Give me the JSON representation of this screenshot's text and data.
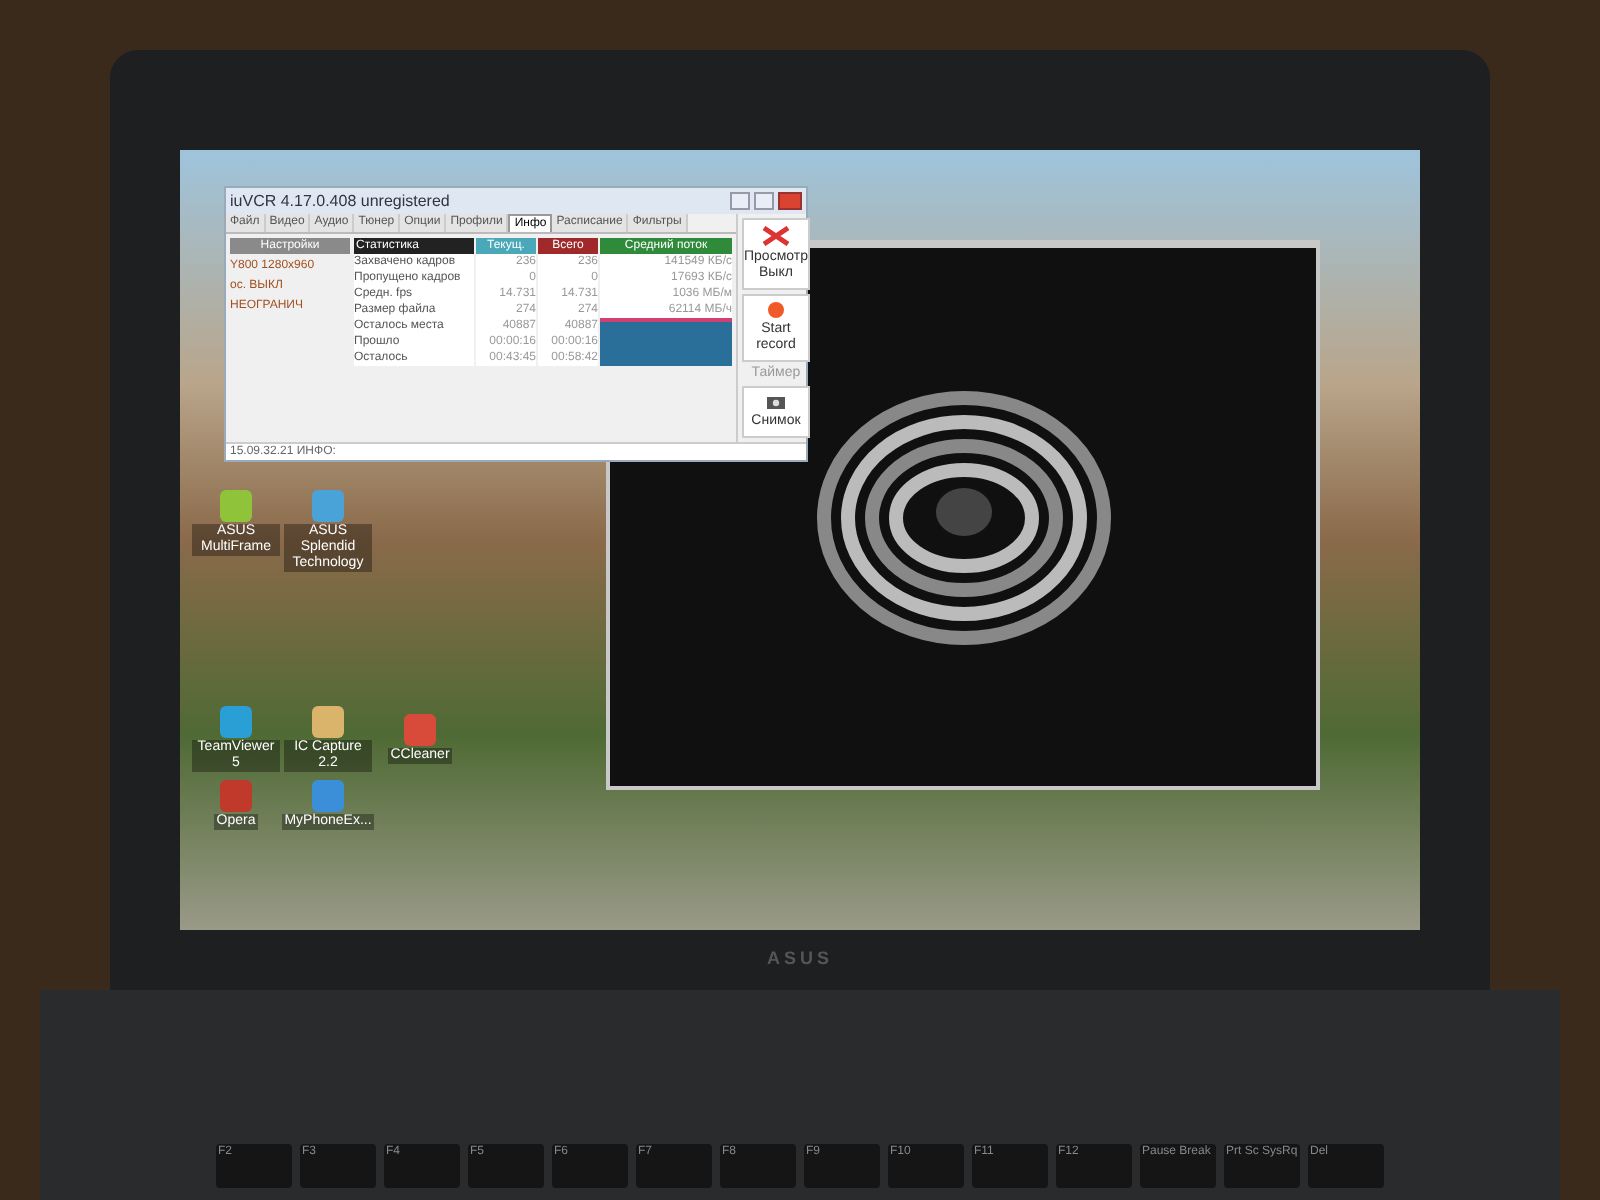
{
  "iuvcr_window": {
    "title": "iuVCR 4.17.0.408 unregistered",
    "tabs": [
      {
        "label": "Файл",
        "selected": false
      },
      {
        "label": "Видео",
        "selected": false
      },
      {
        "label": "Аудио",
        "selected": false
      },
      {
        "label": "Тюнер",
        "selected": false
      },
      {
        "label": "Опции",
        "selected": false
      },
      {
        "label": "Профили",
        "selected": false
      },
      {
        "label": "Инфо",
        "selected": true
      },
      {
        "label": "Расписание",
        "selected": false
      },
      {
        "label": "Фильтры",
        "selected": false
      }
    ],
    "settings": {
      "header": "Настройки",
      "lines": [
        "Y800 1280x960",
        "ос. ВЫКЛ",
        "НЕОГРАНИЧ"
      ]
    },
    "stats": {
      "columns": [
        "Статистика",
        "Текущ.",
        "Всего",
        "Средний поток"
      ],
      "rows": [
        {
          "cells": [
            "Захвачено кадров",
            "236",
            "236",
            "141549 КБ/с"
          ]
        },
        {
          "cells": [
            "Пропущено кадров",
            "0",
            "0",
            "17693 КБ/с"
          ]
        },
        {
          "cells": [
            "Средн. fps",
            "14.731",
            "14.731",
            "1036 МБ/м"
          ]
        },
        {
          "cells": [
            "Размер файла",
            "274",
            "274",
            "62114 МБ/ч"
          ]
        },
        {
          "cells": [
            "Осталось места",
            "40887",
            "40887",
            ""
          ]
        },
        {
          "cells": [
            "Прошло",
            "00:00:16",
            "00:00:16",
            ""
          ]
        },
        {
          "cells": [
            "Осталось",
            "00:43:45",
            "00:58:42",
            ""
          ]
        }
      ]
    },
    "actions": [
      {
        "kind": "preview",
        "label": "Просмотр Выкл"
      },
      {
        "kind": "record",
        "label": "Start record"
      },
      {
        "kind": "timer",
        "label": "Таймер"
      },
      {
        "kind": "snapshot",
        "label": "Снимок"
      }
    ],
    "log": "15.09.32.21 ИНФО:"
  },
  "desktop": {
    "icons": [
      {
        "label": "ASUS MultiFrame"
      },
      {
        "label": "ASUS Splendid Technology"
      },
      {
        "label": "TeamViewer 5"
      },
      {
        "label": "IC Capture 2.2"
      },
      {
        "label": "CCleaner"
      },
      {
        "label": "Opera"
      },
      {
        "label": "MyPhoneEx..."
      }
    ]
  },
  "bezel": {
    "logo": "ASUS"
  },
  "keyboard": {
    "keys": [
      "F2",
      "F3",
      "F4",
      "F5",
      "F6",
      "F7",
      "F8",
      "F9",
      "F10",
      "F11",
      "F12",
      "Pause Break",
      "Prt Sc SysRq",
      "Del"
    ]
  }
}
